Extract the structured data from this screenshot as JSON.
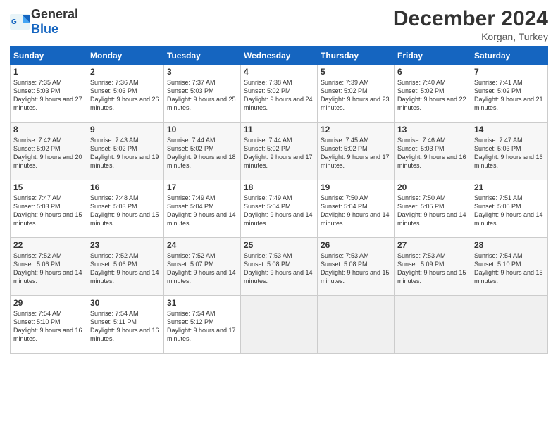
{
  "logo": {
    "text_general": "General",
    "text_blue": "Blue"
  },
  "title": "December 2024",
  "location": "Korgan, Turkey",
  "days_of_week": [
    "Sunday",
    "Monday",
    "Tuesday",
    "Wednesday",
    "Thursday",
    "Friday",
    "Saturday"
  ],
  "weeks": [
    [
      {
        "num": "1",
        "sunrise": "7:35 AM",
        "sunset": "5:03 PM",
        "daylight": "9 hours and 27 minutes."
      },
      {
        "num": "2",
        "sunrise": "7:36 AM",
        "sunset": "5:03 PM",
        "daylight": "9 hours and 26 minutes."
      },
      {
        "num": "3",
        "sunrise": "7:37 AM",
        "sunset": "5:03 PM",
        "daylight": "9 hours and 25 minutes."
      },
      {
        "num": "4",
        "sunrise": "7:38 AM",
        "sunset": "5:02 PM",
        "daylight": "9 hours and 24 minutes."
      },
      {
        "num": "5",
        "sunrise": "7:39 AM",
        "sunset": "5:02 PM",
        "daylight": "9 hours and 23 minutes."
      },
      {
        "num": "6",
        "sunrise": "7:40 AM",
        "sunset": "5:02 PM",
        "daylight": "9 hours and 22 minutes."
      },
      {
        "num": "7",
        "sunrise": "7:41 AM",
        "sunset": "5:02 PM",
        "daylight": "9 hours and 21 minutes."
      }
    ],
    [
      {
        "num": "8",
        "sunrise": "7:42 AM",
        "sunset": "5:02 PM",
        "daylight": "9 hours and 20 minutes."
      },
      {
        "num": "9",
        "sunrise": "7:43 AM",
        "sunset": "5:02 PM",
        "daylight": "9 hours and 19 minutes."
      },
      {
        "num": "10",
        "sunrise": "7:44 AM",
        "sunset": "5:02 PM",
        "daylight": "9 hours and 18 minutes."
      },
      {
        "num": "11",
        "sunrise": "7:44 AM",
        "sunset": "5:02 PM",
        "daylight": "9 hours and 17 minutes."
      },
      {
        "num": "12",
        "sunrise": "7:45 AM",
        "sunset": "5:02 PM",
        "daylight": "9 hours and 17 minutes."
      },
      {
        "num": "13",
        "sunrise": "7:46 AM",
        "sunset": "5:03 PM",
        "daylight": "9 hours and 16 minutes."
      },
      {
        "num": "14",
        "sunrise": "7:47 AM",
        "sunset": "5:03 PM",
        "daylight": "9 hours and 16 minutes."
      }
    ],
    [
      {
        "num": "15",
        "sunrise": "7:47 AM",
        "sunset": "5:03 PM",
        "daylight": "9 hours and 15 minutes."
      },
      {
        "num": "16",
        "sunrise": "7:48 AM",
        "sunset": "5:03 PM",
        "daylight": "9 hours and 15 minutes."
      },
      {
        "num": "17",
        "sunrise": "7:49 AM",
        "sunset": "5:04 PM",
        "daylight": "9 hours and 14 minutes."
      },
      {
        "num": "18",
        "sunrise": "7:49 AM",
        "sunset": "5:04 PM",
        "daylight": "9 hours and 14 minutes."
      },
      {
        "num": "19",
        "sunrise": "7:50 AM",
        "sunset": "5:04 PM",
        "daylight": "9 hours and 14 minutes."
      },
      {
        "num": "20",
        "sunrise": "7:50 AM",
        "sunset": "5:05 PM",
        "daylight": "9 hours and 14 minutes."
      },
      {
        "num": "21",
        "sunrise": "7:51 AM",
        "sunset": "5:05 PM",
        "daylight": "9 hours and 14 minutes."
      }
    ],
    [
      {
        "num": "22",
        "sunrise": "7:52 AM",
        "sunset": "5:06 PM",
        "daylight": "9 hours and 14 minutes."
      },
      {
        "num": "23",
        "sunrise": "7:52 AM",
        "sunset": "5:06 PM",
        "daylight": "9 hours and 14 minutes."
      },
      {
        "num": "24",
        "sunrise": "7:52 AM",
        "sunset": "5:07 PM",
        "daylight": "9 hours and 14 minutes."
      },
      {
        "num": "25",
        "sunrise": "7:53 AM",
        "sunset": "5:08 PM",
        "daylight": "9 hours and 14 minutes."
      },
      {
        "num": "26",
        "sunrise": "7:53 AM",
        "sunset": "5:08 PM",
        "daylight": "9 hours and 15 minutes."
      },
      {
        "num": "27",
        "sunrise": "7:53 AM",
        "sunset": "5:09 PM",
        "daylight": "9 hours and 15 minutes."
      },
      {
        "num": "28",
        "sunrise": "7:54 AM",
        "sunset": "5:10 PM",
        "daylight": "9 hours and 15 minutes."
      }
    ],
    [
      {
        "num": "29",
        "sunrise": "7:54 AM",
        "sunset": "5:10 PM",
        "daylight": "9 hours and 16 minutes."
      },
      {
        "num": "30",
        "sunrise": "7:54 AM",
        "sunset": "5:11 PM",
        "daylight": "9 hours and 16 minutes."
      },
      {
        "num": "31",
        "sunrise": "7:54 AM",
        "sunset": "5:12 PM",
        "daylight": "9 hours and 17 minutes."
      },
      null,
      null,
      null,
      null
    ]
  ]
}
